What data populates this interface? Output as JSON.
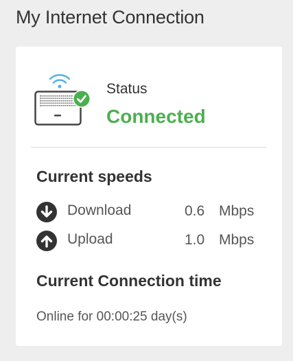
{
  "page": {
    "title": "My Internet Connection"
  },
  "status": {
    "label": "Status",
    "value": "Connected",
    "color": "#4caf50"
  },
  "icons": {
    "device": "router-with-wifi-check-icon",
    "download": "arrow-down-circle-icon",
    "upload": "arrow-up-circle-icon"
  },
  "speeds": {
    "title": "Current speeds",
    "download": {
      "label": "Download",
      "value": "0.6",
      "unit": "Mbps"
    },
    "upload": {
      "label": "Upload",
      "value": "1.0",
      "unit": "Mbps"
    }
  },
  "connection_time": {
    "title": "Current Connection time",
    "text": "Online for 00:00:25 day(s)"
  }
}
